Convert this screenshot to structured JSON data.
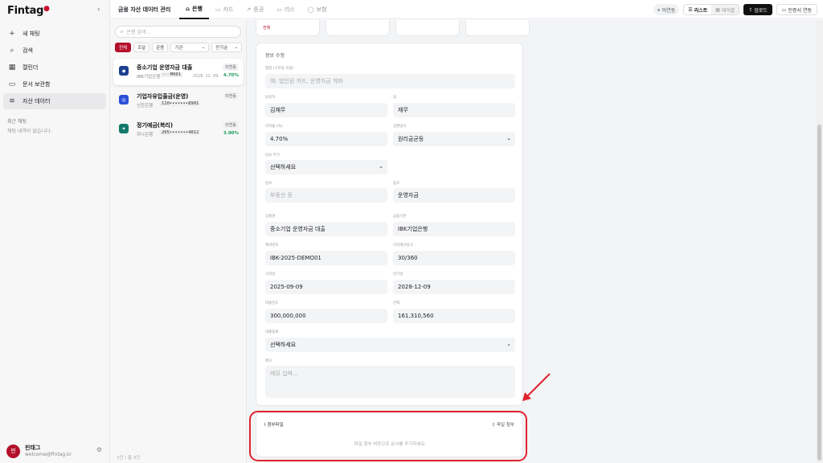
{
  "sidebar": {
    "logo": "Fintag",
    "collapse_icon": "chevron-left-icon",
    "items": [
      {
        "icon": "plus-icon",
        "glyph": "+",
        "label": "새 채팅"
      },
      {
        "icon": "search-icon",
        "glyph": "⌕",
        "label": "검색"
      },
      {
        "icon": "calendar-icon",
        "glyph": "▦",
        "label": "캘린더"
      },
      {
        "icon": "folder-icon",
        "glyph": "▭",
        "label": "문서 보관함"
      },
      {
        "icon": "database-icon",
        "glyph": "≋",
        "label": "자산 데이터"
      }
    ],
    "recent_title": "최근 채팅",
    "recent_empty": "채팅 내역이 없습니다.",
    "user": {
      "avatar": "핀",
      "name": "핀태그",
      "email": "welcome@fintag.kr"
    }
  },
  "topbar": {
    "title": "금융 자산 데이터 관리",
    "tabs": [
      {
        "icon": "bank-icon",
        "glyph": "⌂",
        "label": "은행"
      },
      {
        "icon": "card-icon",
        "glyph": "▭",
        "label": "카드"
      },
      {
        "icon": "chart-icon",
        "glyph": "↗",
        "label": "증권"
      },
      {
        "icon": "lease-icon",
        "glyph": "▭",
        "label": "리스"
      },
      {
        "icon": "shield-icon",
        "glyph": "◯",
        "label": "보험"
      }
    ],
    "status": "미연동",
    "view_list": "리스트",
    "view_table": "테이블",
    "upload": "업로드",
    "cert": "인증서 연동"
  },
  "list": {
    "search_placeholder": "은행 검색...",
    "filters": [
      "전체",
      "조달",
      "운용"
    ],
    "inst_select": "기관",
    "sort_select": "만기순",
    "items": [
      {
        "name": "중소기업 운영자금 대출",
        "bank": "IBK기업은행",
        "account": "···M001",
        "badge": "미연동",
        "date": "2028. 12. 09.",
        "rate": "4.70%",
        "color": "#1c3f8f",
        "glyph": "◆"
      },
      {
        "name": "기업자유입출금(운영)",
        "bank": "신한은행",
        "account": "110•••••••8901",
        "badge": "미연동",
        "date": "",
        "rate": "",
        "color": "#2c4fd8",
        "glyph": "◎"
      },
      {
        "name": "정기예금(복리)",
        "bank": "하나은행",
        "account": "205•••••••4812",
        "badge": "미연동",
        "date": "",
        "rate": "3.90%",
        "color": "#137a6b",
        "glyph": "✦"
      }
    ],
    "count": "3건 / 총 3건"
  },
  "form": {
    "top_tag": "전체",
    "title": "정보 수정",
    "alias_label": "별칭 (구분용 이름)",
    "alias_placeholder": "예: 법인원 카드, 운영자금 계좌",
    "manager_label": "담당자",
    "manager_value": "김재무",
    "team_label": "팀",
    "team_value": "재무",
    "rate_label": "이자율 (%)",
    "rate_value": "4.70%",
    "repay_label": "상환방식",
    "repay_value": "원리금균등",
    "collateral_label": "담보 추가",
    "collateral_value": "선택하세요",
    "security_label": "담보",
    "security_placeholder": "부동산 등",
    "purpose_label": "용도",
    "purpose_value": "운영자금",
    "product_label": "상품명",
    "product_value": "중소기업 운영자금 대출",
    "institution_label": "금융기관",
    "institution_value": "IBK기업은행",
    "account_label": "계약번호",
    "account_value": "IBK-2025-DEMO01",
    "daycount_label": "이자계산방식",
    "daycount_value": "30/360",
    "start_label": "시작일",
    "start_value": "2025-09-09",
    "maturity_label": "만기일",
    "maturity_value": "2028-12-09",
    "limit_label": "대출한도",
    "limit_value": "300,000,000",
    "balance_label": "잔액",
    "balance_value": "161,310,560",
    "loantype_label": "대출종류",
    "loantype_value": "선택하세요",
    "memo_label": "메모",
    "memo_placeholder": "메모 입력..."
  },
  "attachments": {
    "title": "첨부파일",
    "button": "파일 첨부",
    "empty": "파일 첨부 버튼으로 문서를 추가하세요."
  },
  "annotation_color": "#e0242f"
}
